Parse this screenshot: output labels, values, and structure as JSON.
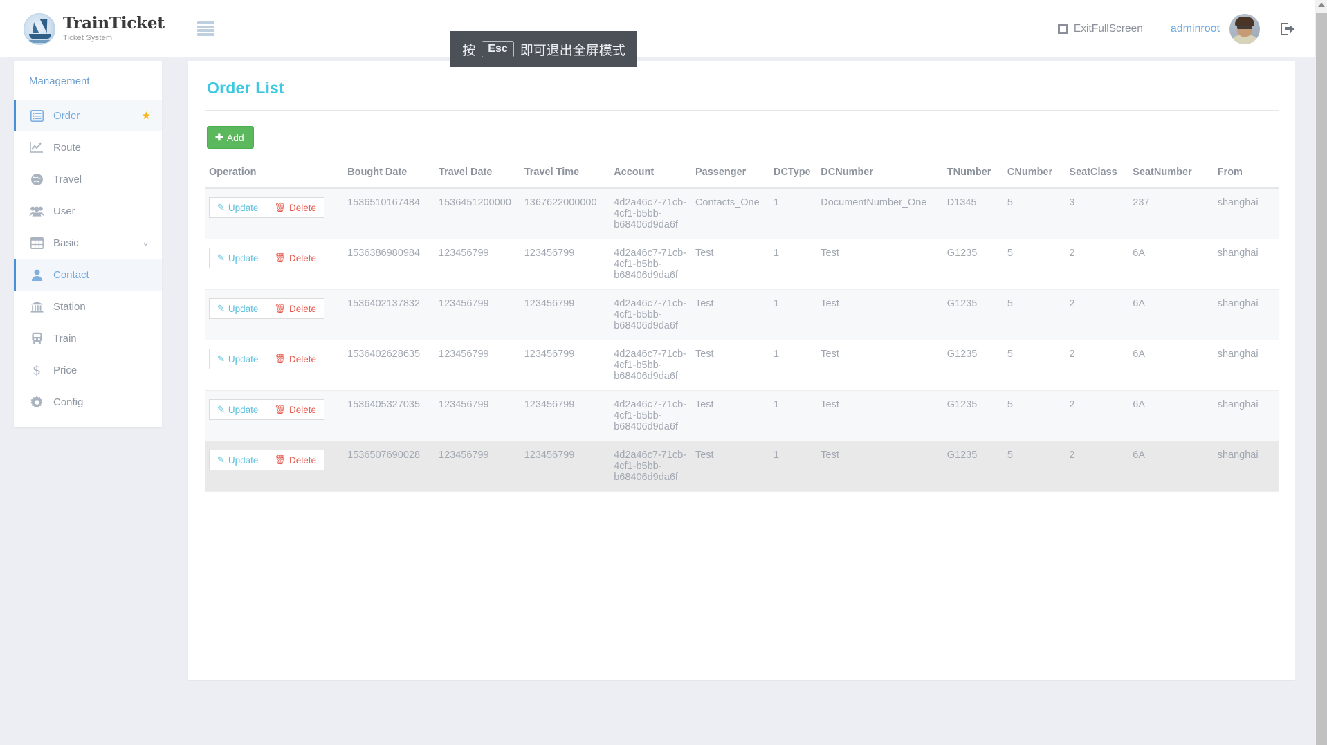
{
  "brand": {
    "title": "TrainTicket",
    "subtitle": "Ticket System",
    "logo_icon": "sailboat-logo-icon",
    "menu_icon": "hamburger-menu-icon"
  },
  "topbar": {
    "exit_fullscreen_label": "ExitFullScreen",
    "exit_fullscreen_icon": "expand-arrows-icon",
    "username": "adminroot",
    "avatar_icon": "user-avatar",
    "logout_icon": "logout-icon"
  },
  "fullscreen_toast": {
    "prefix": "按",
    "key": "Esc",
    "suffix": "即可退出全屏模式"
  },
  "sidebar": {
    "heading": "Management",
    "items": [
      {
        "label": "Order",
        "icon": "list-table-icon",
        "active": true,
        "badge": "★"
      },
      {
        "label": "Route",
        "icon": "chart-line-icon",
        "active": false
      },
      {
        "label": "Travel",
        "icon": "globe-icon",
        "active": false
      },
      {
        "label": "User",
        "icon": "users-icon",
        "active": false
      },
      {
        "label": "Basic",
        "icon": "grid-table-icon",
        "active": false,
        "chevron": "⌄"
      },
      {
        "label": "Contact",
        "icon": "person-icon",
        "active": true,
        "sub": true
      },
      {
        "label": "Station",
        "icon": "bank-icon",
        "active": false,
        "sub": true
      },
      {
        "label": "Train",
        "icon": "train-icon",
        "active": false,
        "sub": true
      },
      {
        "label": "Price",
        "icon": "dollar-icon",
        "active": false,
        "sub": true
      },
      {
        "label": "Config",
        "icon": "gear-icon",
        "active": false,
        "sub": true
      }
    ]
  },
  "main": {
    "title": "Order List",
    "add_button": {
      "label": "Add",
      "icon": "plus-icon"
    },
    "row_actions": {
      "update_label": "Update",
      "update_icon": "pencil-square-icon",
      "delete_label": "Delete",
      "delete_icon": "trash-icon"
    },
    "columns": [
      "Operation",
      "Bought Date",
      "Travel Date",
      "Travel Time",
      "Account",
      "Passenger",
      "DCType",
      "DCNumber",
      "TNumber",
      "CNumber",
      "SeatClass",
      "SeatNumber",
      "From"
    ],
    "rows": [
      {
        "bought_date": "1536510167484",
        "travel_date": "1536451200000",
        "travel_time": "1367622000000",
        "account": "4d2a46c7-71cb-4cf1-b5bb-b68406d9da6f",
        "passenger": "Contacts_One",
        "dc_type": "1",
        "dc_number": "DocumentNumber_One",
        "t_number": "D1345",
        "c_number": "5",
        "seat_class": "3",
        "seat_number": "237",
        "from": "shanghai"
      },
      {
        "bought_date": "1536386980984",
        "travel_date": "123456799",
        "travel_time": "123456799",
        "account": "4d2a46c7-71cb-4cf1-b5bb-b68406d9da6f",
        "passenger": "Test",
        "dc_type": "1",
        "dc_number": "Test",
        "t_number": "G1235",
        "c_number": "5",
        "seat_class": "2",
        "seat_number": "6A",
        "from": "shanghai"
      },
      {
        "bought_date": "1536402137832",
        "travel_date": "123456799",
        "travel_time": "123456799",
        "account": "4d2a46c7-71cb-4cf1-b5bb-b68406d9da6f",
        "passenger": "Test",
        "dc_type": "1",
        "dc_number": "Test",
        "t_number": "G1235",
        "c_number": "5",
        "seat_class": "2",
        "seat_number": "6A",
        "from": "shanghai"
      },
      {
        "bought_date": "1536402628635",
        "travel_date": "123456799",
        "travel_time": "123456799",
        "account": "4d2a46c7-71cb-4cf1-b5bb-b68406d9da6f",
        "passenger": "Test",
        "dc_type": "1",
        "dc_number": "Test",
        "t_number": "G1235",
        "c_number": "5",
        "seat_class": "2",
        "seat_number": "6A",
        "from": "shanghai"
      },
      {
        "bought_date": "1536405327035",
        "travel_date": "123456799",
        "travel_time": "123456799",
        "account": "4d2a46c7-71cb-4cf1-b5bb-b68406d9da6f",
        "passenger": "Test",
        "dc_type": "1",
        "dc_number": "Test",
        "t_number": "G1235",
        "c_number": "5",
        "seat_class": "2",
        "seat_number": "6A",
        "from": "shanghai"
      },
      {
        "bought_date": "1536507690028",
        "travel_date": "123456799",
        "travel_time": "123456799",
        "account": "4d2a46c7-71cb-4cf1-b5bb-b68406d9da6f",
        "passenger": "Test",
        "dc_type": "1",
        "dc_number": "Test",
        "t_number": "G1235",
        "c_number": "5",
        "seat_class": "2",
        "seat_number": "6A",
        "from": "shanghai"
      }
    ]
  },
  "colors": {
    "page_title": "#3bc8e0",
    "accent_blue": "#4a90d9",
    "add_green": "#5cb85c",
    "delete_red": "#e8584c",
    "star_gold": "#f9b617",
    "background": "#eceef3"
  }
}
